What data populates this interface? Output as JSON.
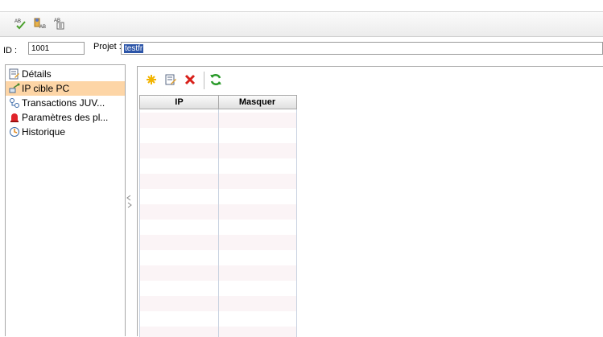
{
  "toolbar": {
    "icons": [
      "spellcheck-icon",
      "spellcheck-person-icon",
      "thesaurus-icon"
    ]
  },
  "record": {
    "id_label": "ID :",
    "id_value": "1001",
    "project_label": "Projet :",
    "project_value": "testfr"
  },
  "sidebar": {
    "items": [
      {
        "label": "Détails",
        "icon": "details-icon",
        "selected": false
      },
      {
        "label": "IP cible PC",
        "icon": "network-target-icon",
        "selected": true
      },
      {
        "label": "Transactions JUV...",
        "icon": "transactions-icon",
        "selected": false
      },
      {
        "label": "Paramètres des pl...",
        "icon": "alarm-icon",
        "selected": false
      },
      {
        "label": "Historique",
        "icon": "history-icon",
        "selected": false
      }
    ]
  },
  "grid_toolbar": {
    "icons": [
      "new-icon",
      "edit-icon",
      "delete-icon",
      "refresh-icon"
    ]
  },
  "grid": {
    "columns": [
      "IP",
      "Masquer"
    ],
    "rows": []
  },
  "colors": {
    "selected_item_bg": "#fdd5a6",
    "selection_highlight": "#2c55a8",
    "alt_row": "#fbf4f6"
  }
}
